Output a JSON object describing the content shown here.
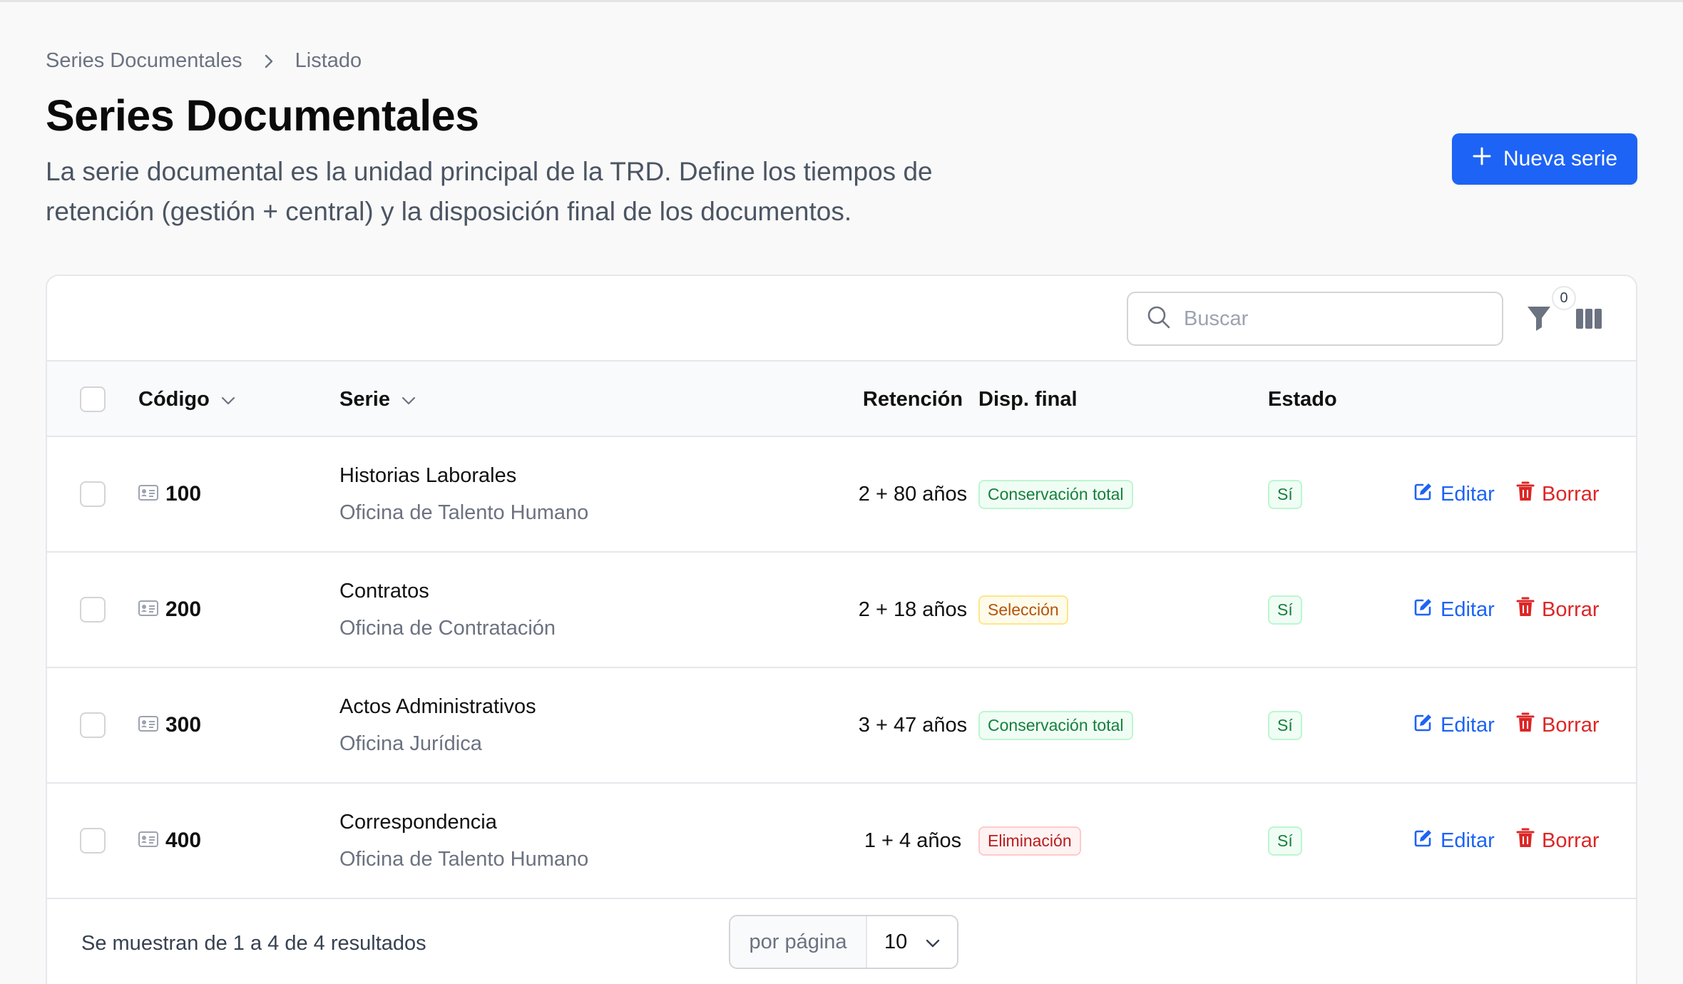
{
  "breadcrumb": {
    "parent": "Series Documentales",
    "current": "Listado"
  },
  "header": {
    "title": "Series Documentales",
    "description": "La serie documental es la unidad principal de la TRD. Define los tiempos de retención (gestión + central) y la disposición final de los documentos.",
    "new_button": "Nueva serie"
  },
  "toolbar": {
    "search_placeholder": "Buscar",
    "filter_count": "0"
  },
  "table": {
    "columns": {
      "codigo": "Código",
      "serie": "Serie",
      "retencion": "Retención",
      "disp_final": "Disp. final",
      "estado": "Estado"
    },
    "rows": [
      {
        "codigo": "100",
        "serie": "Historias Laborales",
        "oficina": "Oficina de Talento Humano",
        "retencion": "2 + 80 años",
        "disp_final": "Conservación total",
        "disp_color": "green",
        "estado": "Sí",
        "edit": "Editar",
        "delete": "Borrar"
      },
      {
        "codigo": "200",
        "serie": "Contratos",
        "oficina": "Oficina de Contratación",
        "retencion": "2 + 18 años",
        "disp_final": "Selección",
        "disp_color": "yellow",
        "estado": "Sí",
        "edit": "Editar",
        "delete": "Borrar"
      },
      {
        "codigo": "300",
        "serie": "Actos Administrativos",
        "oficina": "Oficina Jurídica",
        "retencion": "3 + 47 años",
        "disp_final": "Conservación total",
        "disp_color": "green",
        "estado": "Sí",
        "edit": "Editar",
        "delete": "Borrar"
      },
      {
        "codigo": "400",
        "serie": "Correspondencia",
        "oficina": "Oficina de Talento Humano",
        "retencion": "1 + 4 años",
        "disp_final": "Eliminación",
        "disp_color": "red",
        "estado": "Sí",
        "edit": "Editar",
        "delete": "Borrar"
      }
    ]
  },
  "footer": {
    "results_text": "Se muestran de 1 a 4 de 4 resultados",
    "per_page_label": "por página",
    "per_page_value": "10"
  },
  "colors": {
    "primary": "#1d63f5",
    "danger": "#dc2626",
    "success": "#15803d",
    "warning": "#b45309"
  }
}
